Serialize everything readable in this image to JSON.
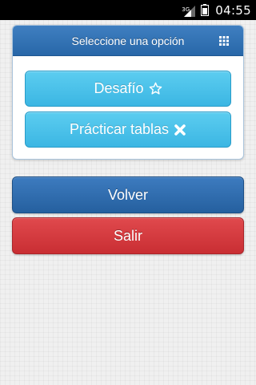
{
  "status_bar": {
    "network_label": "3G",
    "time": "04:55",
    "icons": [
      "signal-icon",
      "battery-icon"
    ]
  },
  "panel": {
    "title": "Seleccione una opción",
    "menu_icon": "grid-icon",
    "options": [
      {
        "label": "Desafío",
        "icon": "star-outline-icon"
      },
      {
        "label": "Prácticar tablas",
        "icon": "close-x-icon"
      }
    ]
  },
  "buttons": {
    "volver": "Volver",
    "salir": "Salir"
  },
  "colors": {
    "header_blue": "#3272b5",
    "option_cyan": "#4cc2ea",
    "volver_blue": "#2f6cae",
    "salir_red": "#d43c40",
    "background": "#f0f0f0"
  }
}
